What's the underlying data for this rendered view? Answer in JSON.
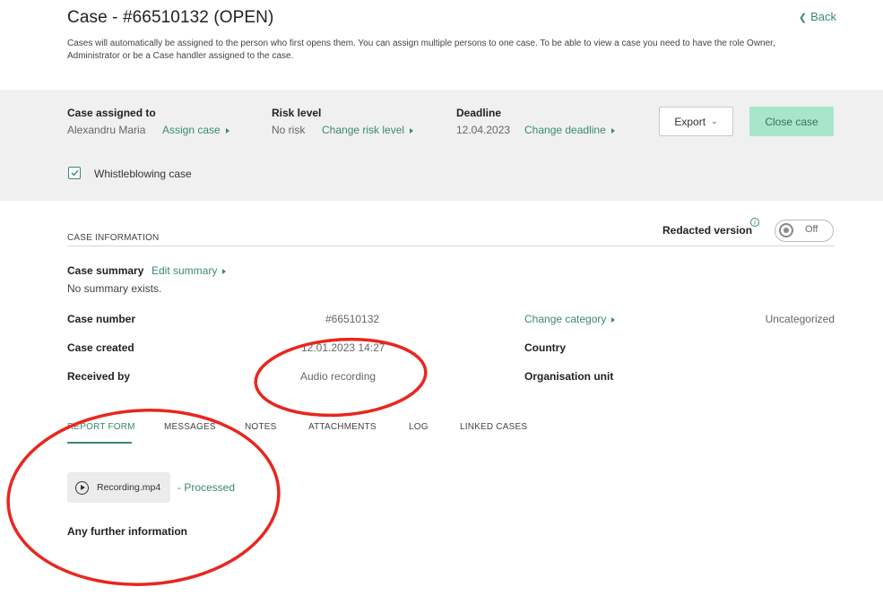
{
  "header": {
    "title": "Case - #66510132 (OPEN)",
    "back_label": "Back",
    "description": "Cases will automatically be assigned to the person who first opens them. You can assign multiple persons to one case. To be able to view a case you need to have the role Owner, Administrator or be a Case handler assigned to the case."
  },
  "summary_bar": {
    "assigned": {
      "label": "Case assigned to",
      "value": "Alexandru Maria",
      "action": "Assign case"
    },
    "risk": {
      "label": "Risk level",
      "value": "No risk",
      "action": "Change risk level"
    },
    "deadline": {
      "label": "Deadline",
      "value": "12.04.2023",
      "action": "Change deadline"
    },
    "export_label": "Export",
    "close_label": "Close case",
    "whistleblowing_label": "Whistleblowing case",
    "whistleblowing_checked": true
  },
  "case_info": {
    "section_title": "CASE INFORMATION",
    "redacted_label": "Redacted version",
    "redacted_toggle": "Off",
    "summary_label": "Case summary",
    "edit_summary": "Edit summary",
    "summary_text": "No summary exists.",
    "rows": [
      {
        "label": "Case number",
        "value": "#66510132"
      },
      {
        "label": "Case created",
        "value": "12.01.2023 14:27"
      },
      {
        "label": "Received by",
        "value": "Audio recording"
      }
    ],
    "change_category": "Change category",
    "category_value": "Uncategorized",
    "country_label": "Country",
    "org_unit_label": "Organisation unit"
  },
  "tabs": [
    "REPORT FORM",
    "MESSAGES",
    "NOTES",
    "ATTACHMENTS",
    "LOG",
    "LINKED CASES"
  ],
  "active_tab": "REPORT FORM",
  "report": {
    "file_name": "Recording.mp4",
    "file_status": "- Processed",
    "further_info_label": "Any further information"
  },
  "colors": {
    "accent": "#3a8a6e",
    "close_button": "#a8e6cc",
    "band": "#f0f0f0",
    "annotation": "#e8271e"
  },
  "icons": [
    "chevron-left-icon",
    "caret-right-icon",
    "chevron-down-icon",
    "checkmark-icon",
    "info-icon",
    "play-icon"
  ]
}
